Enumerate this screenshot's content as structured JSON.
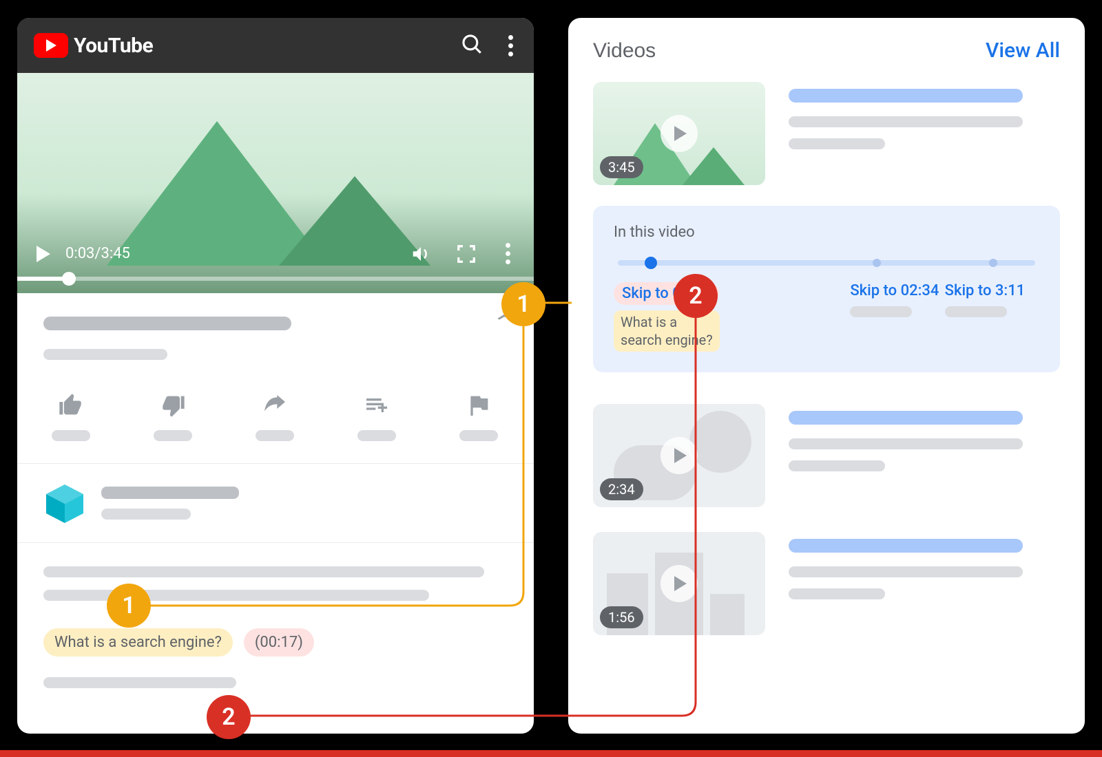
{
  "youtube": {
    "brand": "YouTube",
    "time_current": "0:03",
    "time_sep": " / ",
    "time_total": "3:45",
    "chip_title": "What is a search engine?",
    "chip_time": "(00:17)"
  },
  "google": {
    "section_title": "Videos",
    "view_all": "View All",
    "results": [
      {
        "duration": "3:45"
      },
      {
        "duration": "2:34"
      },
      {
        "duration": "1:56"
      }
    ],
    "key_moments": {
      "heading": "In this video",
      "items": [
        {
          "skip": "Skip to 00:17",
          "title": "What is a search engine?"
        },
        {
          "skip": "Skip to 02:34"
        },
        {
          "skip": "Skip to 3:11"
        }
      ]
    }
  },
  "callouts": {
    "one": "1",
    "two": "2"
  }
}
